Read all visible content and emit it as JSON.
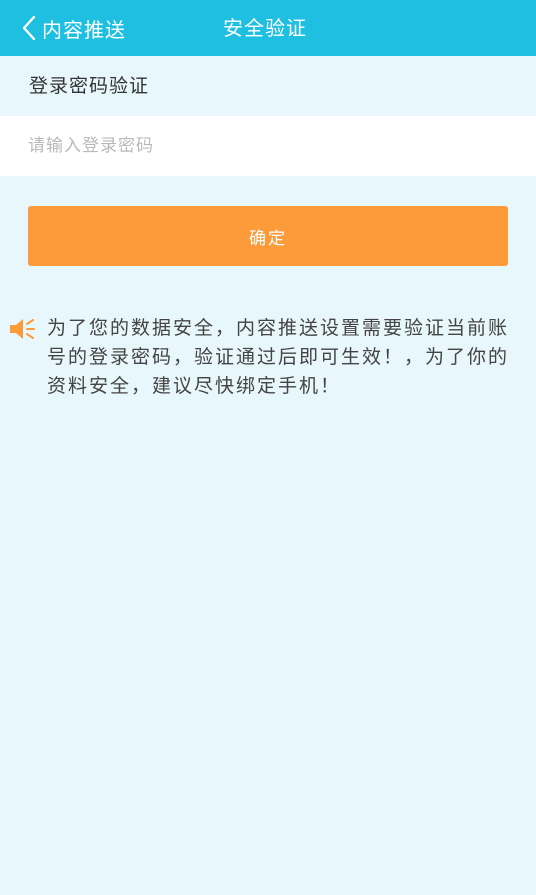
{
  "header": {
    "back_label": "内容推送",
    "title": "安全验证"
  },
  "form": {
    "section_label": "登录密码验证",
    "password_placeholder": "请输入登录密码",
    "password_value": "",
    "confirm_label": "确定"
  },
  "notice": {
    "icon": "speaker-icon",
    "text": "为了您的数据安全，内容推送设置需要验证当前账号的登录密码，验证通过后即可生效！，为了你的资料安全，建议尽快绑定手机！"
  },
  "colors": {
    "header_bg": "#1fbfe2",
    "page_bg": "#e7f7fb",
    "accent": "#fd9a3a"
  }
}
